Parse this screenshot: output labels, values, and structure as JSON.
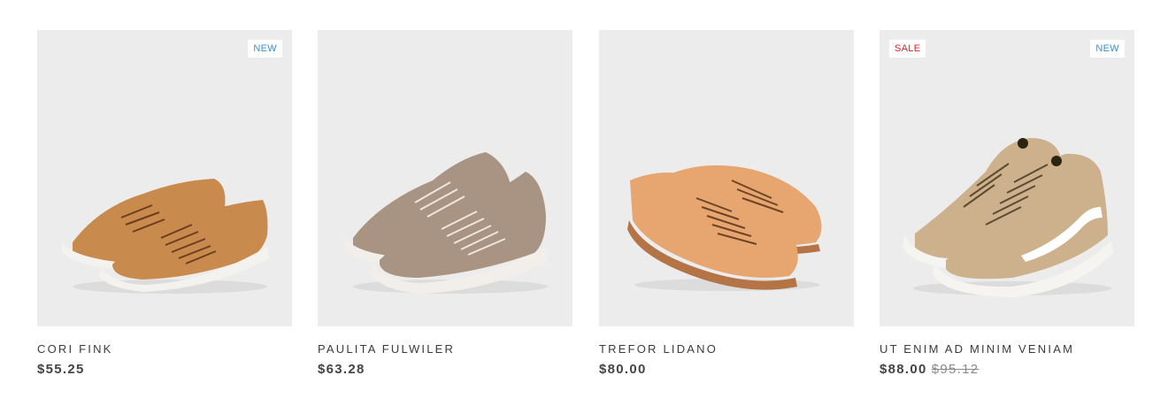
{
  "colors": {
    "tile_background": "#ececec",
    "new_badge": "#3a8fc7",
    "sale_badge": "#d6262b",
    "text": "#3b3b3b",
    "old_price": "#8a8a8a"
  },
  "products": [
    {
      "title": "CORI FINK",
      "price": "$55.25",
      "old_price": "",
      "badges": {
        "sale": "",
        "new": "NEW"
      },
      "image": "tan-leather-low-top-sneakers",
      "shoe_color": "#c98a4e",
      "sole_color": "#f4f2ee"
    },
    {
      "title": "PAULITA FULWILER",
      "price": "$63.28",
      "old_price": "",
      "badges": {
        "sale": "",
        "new": ""
      },
      "image": "taupe-perforated-sneakers",
      "shoe_color": "#a99382",
      "sole_color": "#f2efea"
    },
    {
      "title": "TREFOR LIDANO",
      "price": "$80.00",
      "old_price": "",
      "badges": {
        "sale": "",
        "new": ""
      },
      "image": "natural-leather-derby-shoes",
      "shoe_color": "#e7a570",
      "sole_color": "#b57445"
    },
    {
      "title": "UT ENIM AD MINIM VENIAM",
      "price": "$88.00",
      "old_price": "$95.12",
      "badges": {
        "sale": "SALE",
        "new": "NEW"
      },
      "image": "khaki-high-top-sneakers",
      "shoe_color": "#cdb18d",
      "sole_color": "#f6f4f0"
    }
  ]
}
